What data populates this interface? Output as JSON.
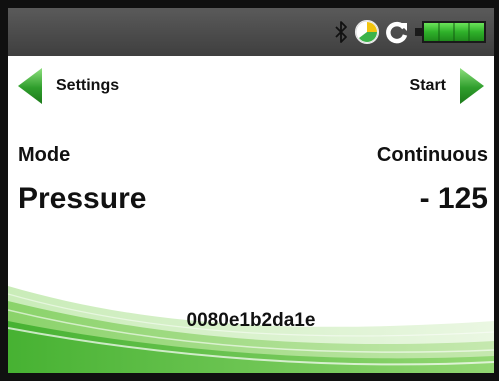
{
  "status_bar": {
    "icons": [
      "bluetooth-icon",
      "pie-clock-icon",
      "refresh-icon",
      "battery-icon"
    ],
    "battery_level": 1.0
  },
  "nav": {
    "left_label": "Settings",
    "right_label": "Start"
  },
  "mode": {
    "label": "Mode",
    "value": "Continuous"
  },
  "pressure": {
    "label": "Pressure",
    "value": "- 125"
  },
  "device_id": "0080e1b2da1e",
  "colors": {
    "accent_green": "#33a532",
    "status_bar_bg": "#4a4a4a",
    "text": "#111111"
  }
}
